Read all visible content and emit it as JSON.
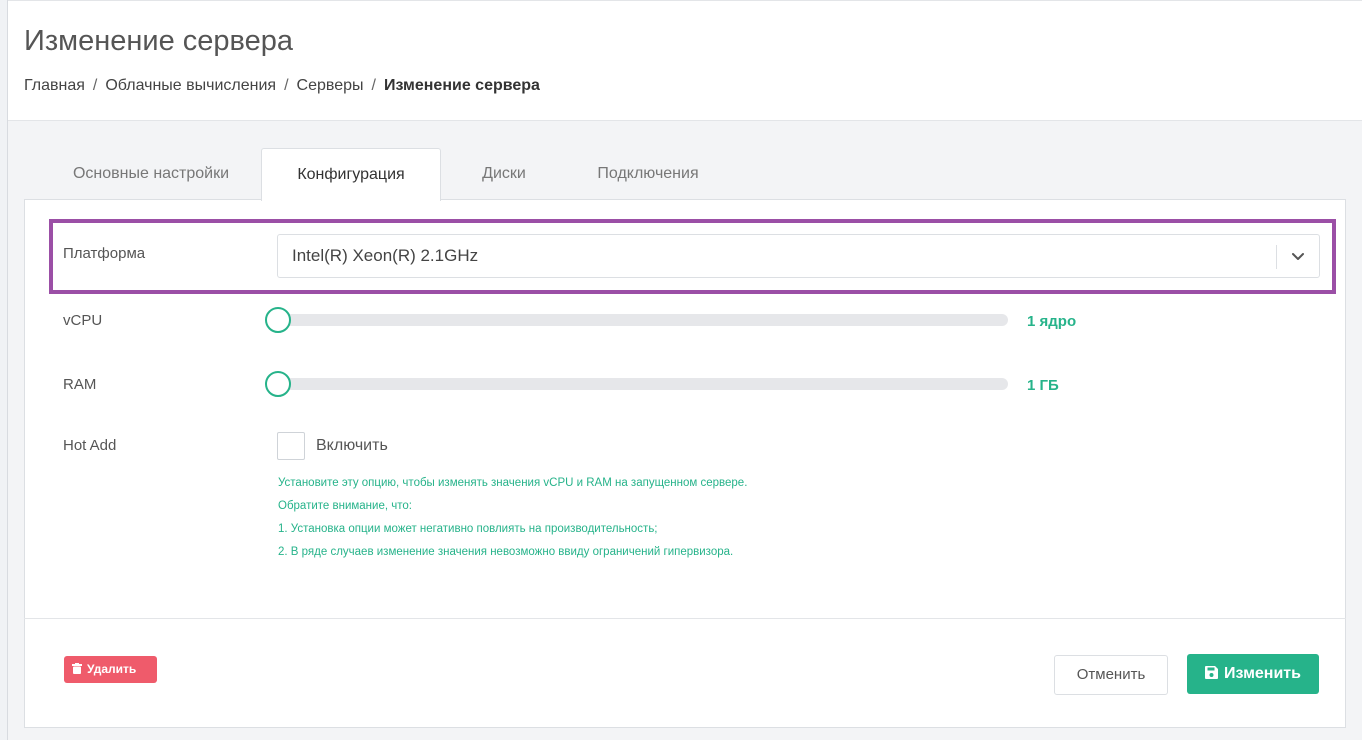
{
  "page": {
    "title": "Изменение сервера"
  },
  "breadcrumb": {
    "items": [
      "Главная",
      "Облачные вычисления",
      "Серверы"
    ],
    "current": "Изменение сервера",
    "separator": "/"
  },
  "tabs": [
    {
      "label": "Основные настройки",
      "active": false
    },
    {
      "label": "Конфигурация",
      "active": true
    },
    {
      "label": "Диски",
      "active": false
    },
    {
      "label": "Подключения",
      "active": false
    }
  ],
  "form": {
    "platform": {
      "label": "Платформа",
      "value": "Intel(R) Xeon(R) 2.1GHz",
      "icon": "chevron-down-icon"
    },
    "vcpu": {
      "label": "vCPU",
      "value_text": "1 ядро",
      "level": 0
    },
    "ram": {
      "label": "RAM",
      "value_text": "1 ГБ",
      "level": 0
    },
    "hot_add": {
      "label": "Hot Add",
      "checkbox_label": "Включить",
      "checked": false,
      "hints": [
        "Установите эту опцию, чтобы изменять значения vCPU и RAM на запущенном сервере.",
        "Обратите внимание, что:",
        "1. Установка опции может негативно повлиять на производительность;",
        "2. В ряде случаев изменение значения невозможно ввиду ограничений гипервизора."
      ]
    }
  },
  "actions": {
    "delete_label": "Удалить",
    "cancel_label": "Отменить",
    "save_label": "Изменить"
  },
  "colors": {
    "accent": "#26b38a",
    "danger": "#ef5b6b",
    "highlight": "#9b4fa6"
  }
}
